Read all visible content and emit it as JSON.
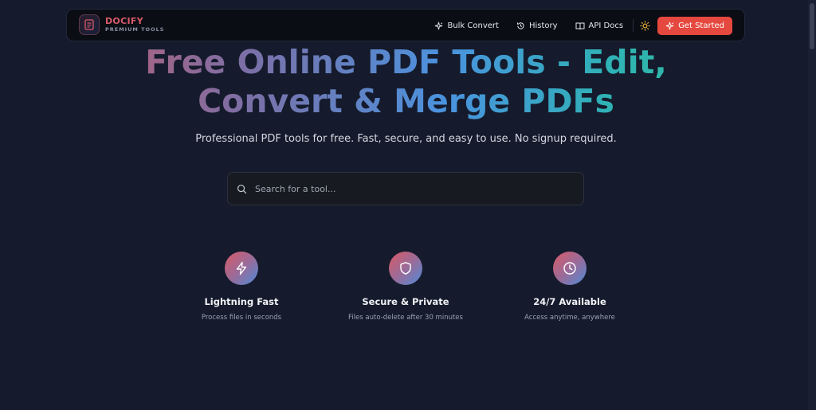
{
  "brand": {
    "name": "DOCIFY",
    "tagline": "PREMIUM TOOLS"
  },
  "nav": {
    "items": [
      {
        "label": "Bulk Convert",
        "icon": "sparkles-icon"
      },
      {
        "label": "History",
        "icon": "history-icon"
      },
      {
        "label": "API Docs",
        "icon": "book-icon"
      }
    ],
    "theme_toggle_icon": "sun-icon",
    "cta_label": "Get Started",
    "cta_icon": "sparkles-icon"
  },
  "hero": {
    "title_line1": "Free Online PDF Tools - Edit,",
    "title_line2": "Convert & Merge PDFs",
    "subtitle": "Professional PDF tools for free. Fast, secure, and easy to use. No signup required."
  },
  "search": {
    "placeholder": "Search for a tool...",
    "value": ""
  },
  "features": [
    {
      "title": "Lightning Fast",
      "description": "Process files in seconds",
      "icon": "lightning-icon"
    },
    {
      "title": "Secure & Private",
      "description": "Files auto-delete after 30 minutes",
      "icon": "shield-icon"
    },
    {
      "title": "24/7 Available",
      "description": "Access anytime, anywhere",
      "icon": "clock-icon"
    }
  ],
  "colors": {
    "background": "#151b2c",
    "navbar": "#0b0d14",
    "accent": "#e5483f",
    "brand": "#d85b6a"
  }
}
